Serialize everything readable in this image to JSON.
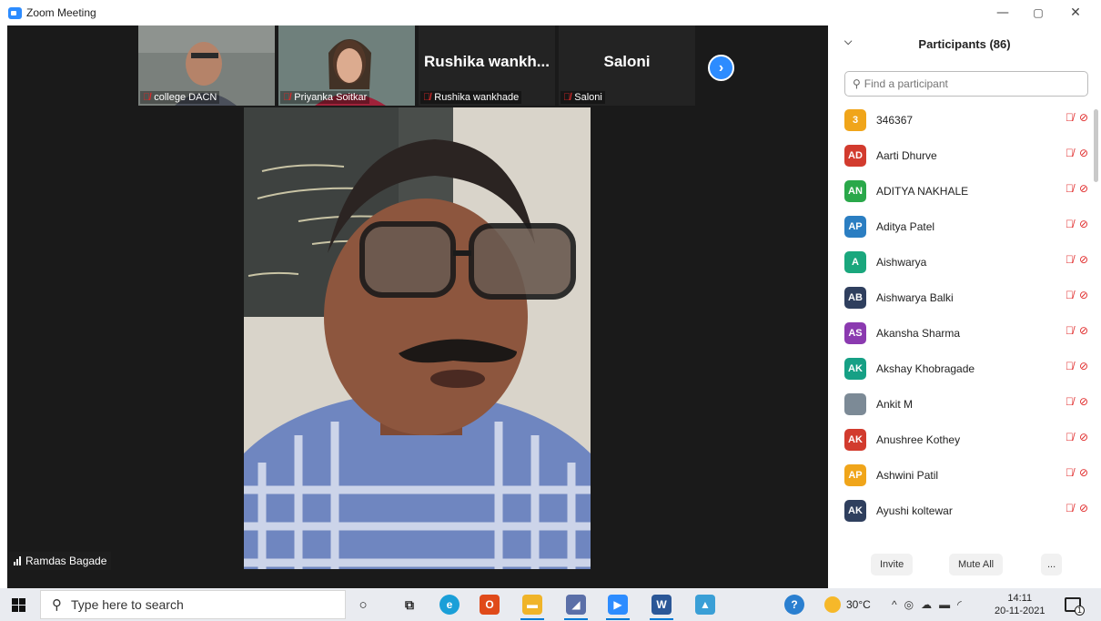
{
  "window": {
    "title": "Zoom Meeting",
    "minimize": "—",
    "restore": "▢",
    "close": "✕"
  },
  "thumbnails": [
    {
      "name": "college DACN",
      "big_label": ""
    },
    {
      "name": "Priyanka Soitkar",
      "big_label": ""
    },
    {
      "name": "Rushika wankhade",
      "big_label": "Rushika  wankh..."
    },
    {
      "name": "Saloni",
      "big_label": "Saloni"
    }
  ],
  "next_icon": "chevron-right-icon",
  "speaker": {
    "name": "Ramdas Bagade"
  },
  "participants": {
    "title": "Participants (86)",
    "search_placeholder": "Find a participant",
    "items": [
      {
        "initials": "3",
        "name": "346367",
        "color": "#f0a51a"
      },
      {
        "initials": "AD",
        "name": "Aarti Dhurve",
        "color": "#d23b2e"
      },
      {
        "initials": "AN",
        "name": "ADITYA NAKHALE",
        "color": "#2aa84a"
      },
      {
        "initials": "AP",
        "name": "Aditya Patel",
        "color": "#2b7ec2"
      },
      {
        "initials": "A",
        "name": "Aishwarya",
        "color": "#1aa77d"
      },
      {
        "initials": "AB",
        "name": "Aishwarya Balki",
        "color": "#2f3f5e"
      },
      {
        "initials": "AS",
        "name": "Akansha Sharma",
        "color": "#8b3ab0"
      },
      {
        "initials": "AK",
        "name": "Akshay Khobragade",
        "color": "#16a085"
      },
      {
        "initials": "",
        "name": "Ankit M",
        "color": "#7c8a96"
      },
      {
        "initials": "AK",
        "name": "Anushree Kothey",
        "color": "#d23b2e"
      },
      {
        "initials": "AP",
        "name": "Ashwini Patil",
        "color": "#f0a51a"
      },
      {
        "initials": "AK",
        "name": "Ayushi koltewar",
        "color": "#2f3f5e"
      }
    ],
    "invite_label": "Invite",
    "mute_all_label": "Mute All",
    "more_label": "..."
  },
  "taskbar": {
    "search_placeholder": "Type here to search",
    "temperature": "30°C",
    "time": "14:11",
    "date": "20-11-2021",
    "notification_count": "1"
  }
}
